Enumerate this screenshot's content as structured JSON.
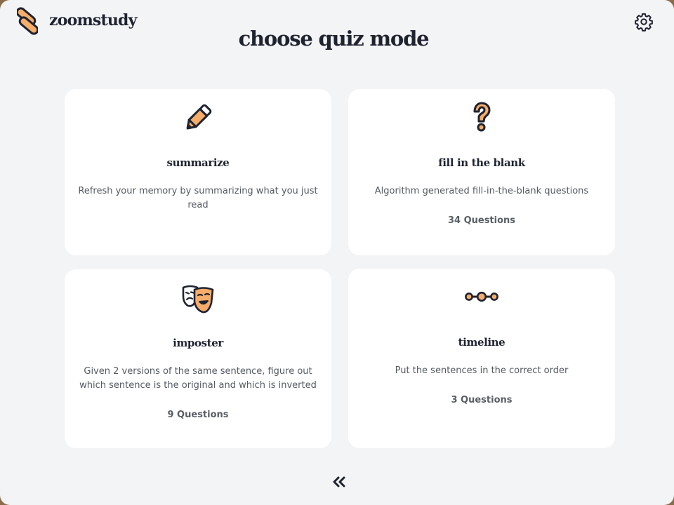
{
  "app": {
    "name": "zoomstudy"
  },
  "page": {
    "title": "choose quiz mode"
  },
  "modes": [
    {
      "title": "summarize",
      "description": "Refresh your memory by summarizing what you just read",
      "count": "",
      "icon": "pencil-icon"
    },
    {
      "title": "fill in the blank",
      "description": "Algorithm generated fill-in-the-blank questions",
      "count": "34 Questions",
      "icon": "question-mark-icon"
    },
    {
      "title": "imposter",
      "description": "Given 2 versions of the same sentence, figure out which sentence is the original and which is inverted",
      "count": "9 Questions",
      "icon": "theater-masks-icon"
    },
    {
      "title": "timeline",
      "description": "Put the sentences in the correct order",
      "count": "3 Questions",
      "icon": "timeline-dots-icon"
    }
  ],
  "navigation": {
    "back_icon": "double-chevron-left-icon",
    "settings_icon": "gear-icon"
  },
  "colors": {
    "accent": "#f6ad6a",
    "ink": "#1f2330",
    "background": "#f3f4f6",
    "card": "#ffffff"
  }
}
